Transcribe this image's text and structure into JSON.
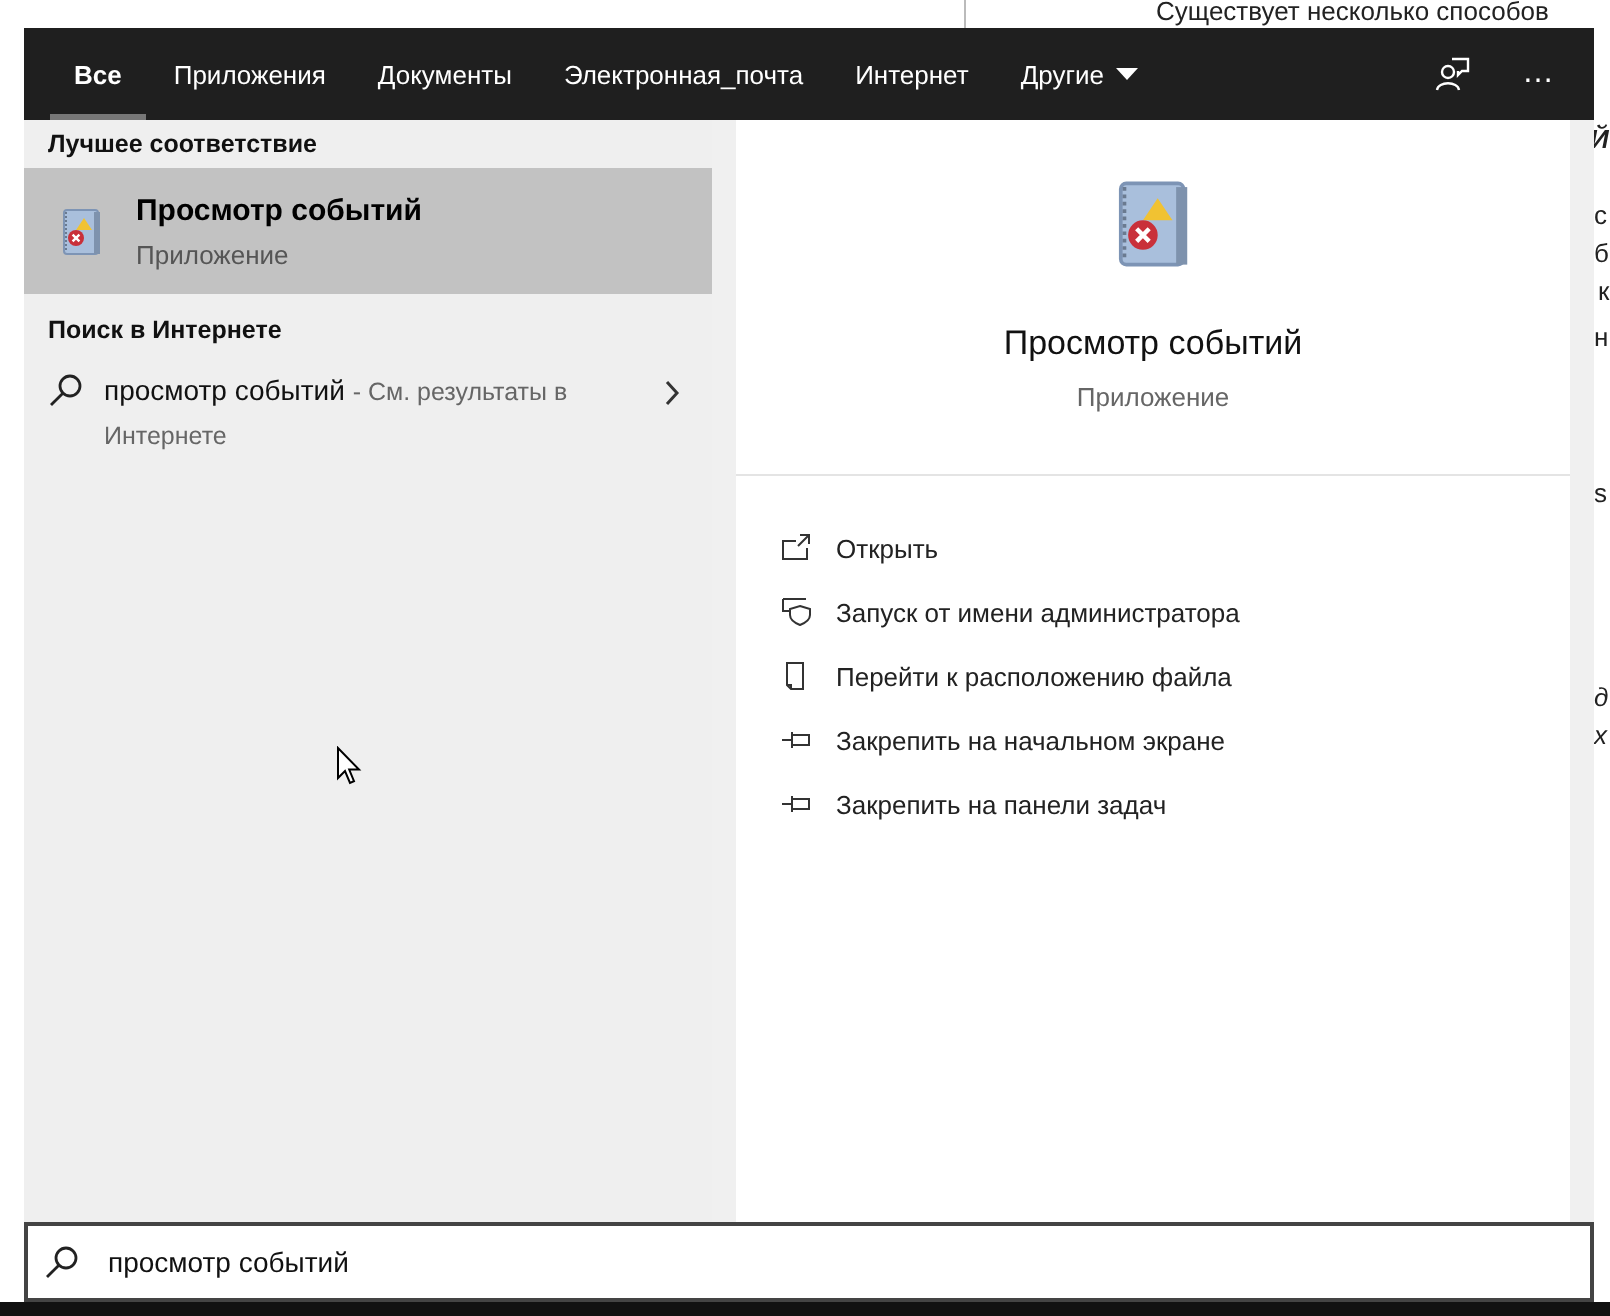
{
  "background_page": {
    "texts": [
      "Существует несколько способов",
      "Й",
      "с",
      "б",
      "к",
      "н",
      "s",
      "д",
      "х"
    ]
  },
  "search_panel": {
    "tabs": [
      {
        "label": "Все",
        "selected": true,
        "kind": "tab"
      },
      {
        "label": "Приложения",
        "selected": false,
        "kind": "tab"
      },
      {
        "label": "Документы",
        "selected": false,
        "kind": "tab"
      },
      {
        "label": "Электронная_почта",
        "selected": false,
        "kind": "tab"
      },
      {
        "label": "Интернет",
        "selected": false,
        "kind": "tab"
      },
      {
        "label": "Другие",
        "selected": false,
        "kind": "dropdown"
      }
    ],
    "toolbar": [
      "…"
    ],
    "best_match": {
      "header": "Лучшее соответствие",
      "item": {
        "title": "Просмотр событий",
        "subtitle": "Приложение",
        "selected": true
      }
    },
    "web_search": {
      "header": "Поиск в Интернете",
      "query": "просмотр событий",
      "hint": "- См. результаты в Интернете"
    },
    "preview": {
      "title": "Просмотр событий",
      "subtitle": "Приложение",
      "actions": [
        {
          "label": "Открыть",
          "kind": "open"
        },
        {
          "label": "Запуск от имени администратора",
          "kind": "admin"
        },
        {
          "label": "Перейти к расположению файла",
          "kind": "folder"
        },
        {
          "label": "Закрепить на начальном экране",
          "kind": "pin"
        },
        {
          "label": "Закрепить на панели задач",
          "kind": "pin"
        }
      ]
    },
    "search_box": {
      "value": "просмотр событий"
    }
  }
}
